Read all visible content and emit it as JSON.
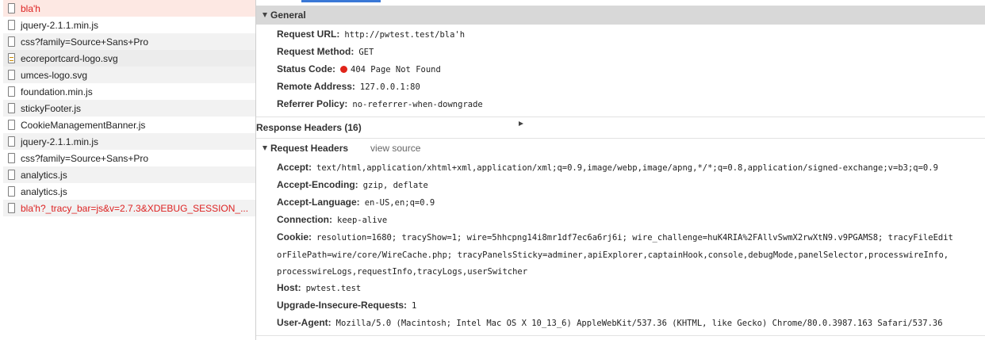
{
  "requests": [
    {
      "name": "bla'h",
      "error": true,
      "icon": "document-icon"
    },
    {
      "name": "jquery-2.1.1.min.js",
      "icon": "document-icon"
    },
    {
      "name": "css?family=Source+Sans+Pro",
      "icon": "document-icon"
    },
    {
      "name": "ecoreportcard-logo.svg",
      "icon": "image-icon"
    },
    {
      "name": "umces-logo.svg",
      "icon": "document-icon"
    },
    {
      "name": "foundation.min.js",
      "icon": "document-icon"
    },
    {
      "name": "stickyFooter.js",
      "icon": "document-icon"
    },
    {
      "name": "CookieManagementBanner.js",
      "icon": "document-icon"
    },
    {
      "name": "jquery-2.1.1.min.js",
      "icon": "document-icon"
    },
    {
      "name": "css?family=Source+Sans+Pro",
      "icon": "document-icon"
    },
    {
      "name": "analytics.js",
      "icon": "document-icon"
    },
    {
      "name": "analytics.js",
      "icon": "document-icon"
    },
    {
      "name": "bla'h?_tracy_bar=js&v=2.7.3&XDEBUG_SESSION_...",
      "error": true,
      "icon": "document-icon"
    }
  ],
  "general": {
    "title": "General",
    "request_url_label": "Request URL:",
    "request_url": "http://pwtest.test/bla'h",
    "request_method_label": "Request Method:",
    "request_method": "GET",
    "status_code_label": "Status Code:",
    "status_code": "404 Page Not Found",
    "remote_address_label": "Remote Address:",
    "remote_address": "127.0.0.1:80",
    "referrer_policy_label": "Referrer Policy:",
    "referrer_policy": "no-referrer-when-downgrade"
  },
  "response_headers": {
    "title": "Response Headers (16)"
  },
  "request_headers": {
    "title": "Request Headers",
    "view_source": "view source",
    "accept_label": "Accept:",
    "accept": "text/html,application/xhtml+xml,application/xml;q=0.9,image/webp,image/apng,*/*;q=0.8,application/signed-exchange;v=b3;q=0.9",
    "accept_encoding_label": "Accept-Encoding:",
    "accept_encoding": "gzip, deflate",
    "accept_language_label": "Accept-Language:",
    "accept_language": "en-US,en;q=0.9",
    "connection_label": "Connection:",
    "connection": "keep-alive",
    "cookie_label": "Cookie:",
    "cookie_line1": "resolution=1680; tracyShow=1; wire=5hhcpng14i8mr1df7ec6a6rj6i; wire_challenge=huK4RIA%2FAllvSwmX2rwXtN9.v9PGAMS8; tracyFileEdit",
    "cookie_line2": "orFilePath=wire/core/WireCache.php; tracyPanelsSticky=adminer,apiExplorer,captainHook,console,debugMode,panelSelector,processwireInfo,",
    "cookie_line3": "processwireLogs,requestInfo,tracyLogs,userSwitcher",
    "host_label": "Host:",
    "host": "pwtest.test",
    "upgrade_label": "Upgrade-Insecure-Requests:",
    "upgrade": "1",
    "user_agent_label": "User-Agent:",
    "user_agent": "Mozilla/5.0 (Macintosh; Intel Mac OS X 10_13_6) AppleWebKit/537.36 (KHTML, like Gecko) Chrome/80.0.3987.163 Safari/537.36"
  }
}
